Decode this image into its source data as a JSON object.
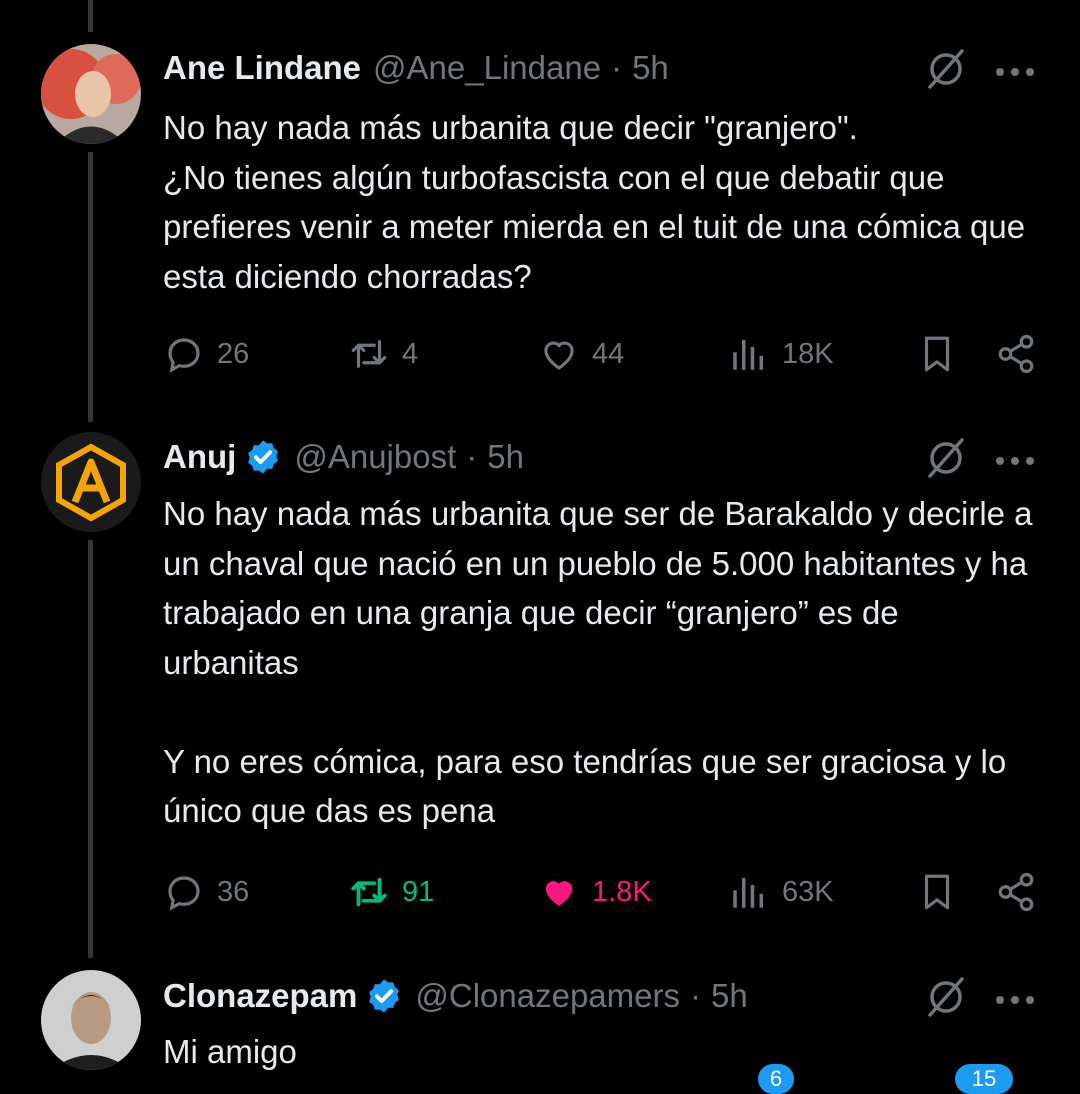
{
  "tweets": [
    {
      "name": "Ane Lindane",
      "handle": "@Ane_Lindane",
      "separator": "·",
      "time": "5h",
      "verified": false,
      "text": "No hay nada más urbanita que decir \"granjero\".\n¿No tienes algún turbofascista con el que debatir que prefieres venir a meter mierda en el tuit de una cómica que esta diciendo chorradas?",
      "replies": "26",
      "retweets": "4",
      "likes": "44",
      "views": "18K"
    },
    {
      "name": "Anuj",
      "handle": "@Anujbost",
      "separator": "·",
      "time": "5h",
      "verified": true,
      "text": "No hay nada más urbanita que ser de Barakaldo y decirle a un chaval que nació en un pueblo de 5.000 habitantes y ha trabajado en una granja que decir “granjero” es de urbanitas\n\nY no eres cómica, para eso tendrías que ser graciosa y lo único que das es pena",
      "replies": "36",
      "retweets": "91",
      "likes": "1.8K",
      "views": "63K"
    },
    {
      "name": "Clonazepam",
      "handle": "@Clonazepamers",
      "separator": "·",
      "time": "5h",
      "verified": true,
      "text": "Mi amigo"
    }
  ],
  "bottom_nav": {
    "badge_1": "6",
    "badge_2": "15"
  },
  "colors": {
    "background": "#000000",
    "text": "#e7e9ea",
    "muted": "#71767b",
    "verified": "#1d9bf0",
    "retweeted": "#00ba7c",
    "liked": "#f91880"
  },
  "icons": [
    "reply-icon",
    "retweet-icon",
    "like-icon",
    "views-icon",
    "bookmark-icon",
    "share-icon",
    "grok-icon",
    "more-icon",
    "verified-icon"
  ]
}
